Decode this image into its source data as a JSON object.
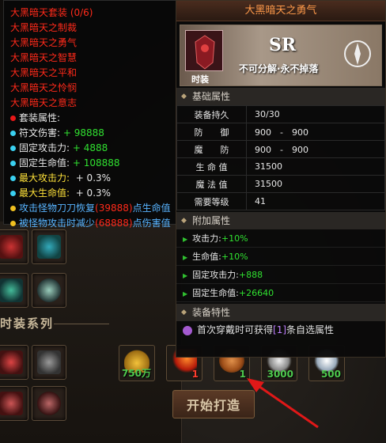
{
  "set_tooltip": {
    "title": "大黑暗天套装 (0/6)",
    "pieces": [
      "大黑暗天之制裁",
      "大黑暗天之勇气",
      "大黑暗天之智慧",
      "大黑暗天之平和",
      "大黑暗天之怜悯",
      "大黑暗天之意志"
    ],
    "set_attr_label": "套装属性:",
    "bonuses": [
      {
        "label": "符文伤害:",
        "value": "+ 98888",
        "label_color": "white",
        "value_color": "green"
      },
      {
        "label": "固定攻击力:",
        "value": "+ 4888",
        "label_color": "white",
        "value_color": "green"
      },
      {
        "label": "固定生命值:",
        "value": "+ 108888",
        "label_color": "white",
        "value_color": "green"
      },
      {
        "label": "最大攻击力:",
        "value": "+ 0.3%",
        "label_color": "yellow",
        "value_color": "white"
      },
      {
        "label": "最大生命值:",
        "value": "+ 0.3%",
        "label_color": "yellow",
        "value_color": "white"
      }
    ],
    "special_1": {
      "prefix": "攻击怪物刀刀恢复",
      "value": "(39888)",
      "suffix": "点生命值"
    },
    "special_2": {
      "prefix": "被怪物攻击时减少",
      "value": "(68888)",
      "suffix": "点伤害值"
    }
  },
  "item_tooltip": {
    "title": "大黑暗天之勇气",
    "icon_label": "时装",
    "rarity": "SR",
    "notice": "不可分解·永不掉落",
    "basic_section": "基础属性",
    "basic_rows": [
      {
        "k": "装备持久",
        "v": "30/30"
      },
      {
        "k": "防　　御",
        "v": "900　-　900"
      },
      {
        "k": "魔　　防",
        "v": "900　-　900"
      },
      {
        "k": "生 命 值",
        "v": "31500"
      },
      {
        "k": "魔 法 值",
        "v": "31500"
      },
      {
        "k": "需要等级",
        "v": "41"
      }
    ],
    "extra_section": "附加属性",
    "extra_rows": [
      {
        "k": "攻击力:",
        "v": "+10%"
      },
      {
        "k": "生命值:",
        "v": "+10%"
      },
      {
        "k": "固定攻击力:",
        "v": "+888"
      },
      {
        "k": "固定生命值:",
        "v": "+26640"
      }
    ],
    "trait_section": "装备特性",
    "trait": {
      "prefix": "首次穿戴时可获得",
      "hl": "[1]",
      "suffix": "条自选属性"
    }
  },
  "background": {
    "series_title": "时装系列",
    "rewards": [
      "750万",
      "1",
      "1",
      "3000",
      "500"
    ],
    "start_button": "开始打造"
  },
  "colors": {
    "accent": "#ff2a1a",
    "value_green": "#30e030",
    "arrow": "#e01818"
  }
}
